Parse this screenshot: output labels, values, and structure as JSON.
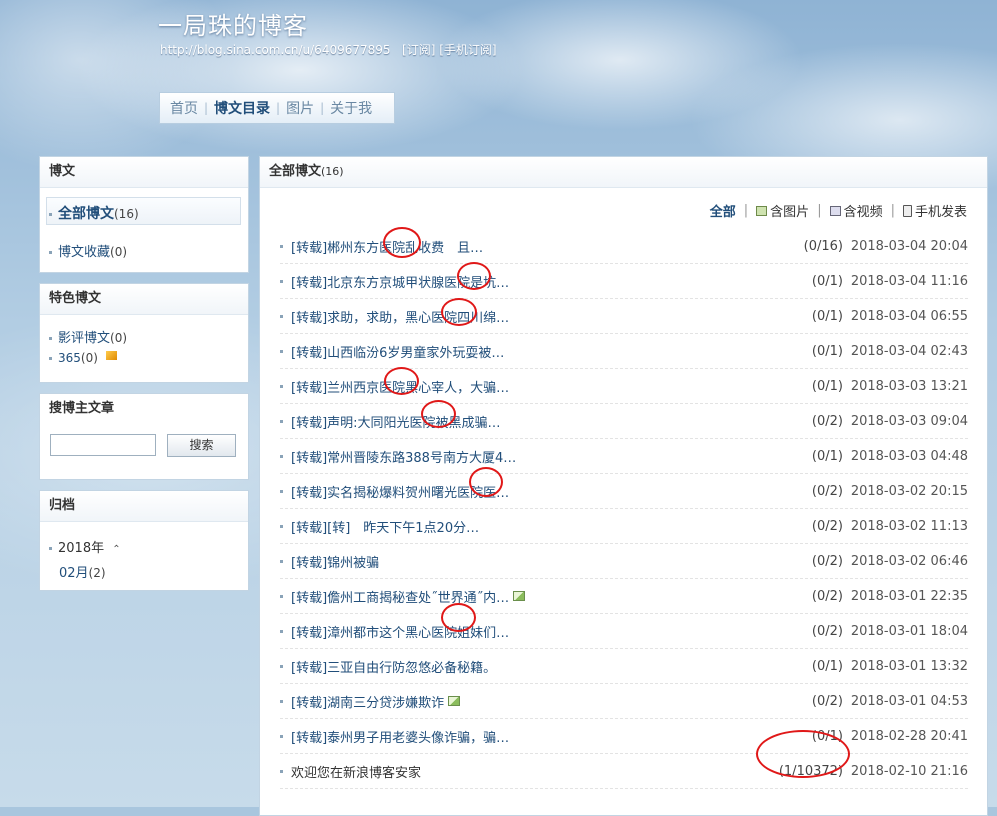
{
  "header": {
    "title": "一局珠的博客",
    "url": "http://blog.sina.com.cn/u/6409677895",
    "subscribe": "[订阅]",
    "mobile_subscribe": "[手机订阅]"
  },
  "nav": {
    "items": [
      {
        "label": "首页",
        "active": false
      },
      {
        "label": "博文目录",
        "active": true
      },
      {
        "label": "图片",
        "active": false
      },
      {
        "label": "关于我",
        "active": false
      }
    ]
  },
  "sidebar": {
    "articles": {
      "title": "博文",
      "all_label": "全部博文",
      "all_count": "(16)",
      "fav_label": "博文收藏",
      "fav_count": "(0)"
    },
    "featured": {
      "title": "特色博文",
      "film_label": "影评博文",
      "film_count": "(0)",
      "c365_label": "365",
      "c365_count": "(0)"
    },
    "search": {
      "title": "搜博主文章",
      "button": "搜索",
      "input_value": ""
    },
    "archive": {
      "title": "归档",
      "year": "2018年",
      "month": "02月",
      "month_count": "(2)"
    }
  },
  "main": {
    "title": "全部博文",
    "count": "(16)",
    "filters": {
      "all": "全部",
      "pictures": "含图片",
      "videos": "含视频",
      "mobile": "手机发表"
    },
    "posts": [
      {
        "title": "[转载]郴州东方医院乱收费　且…",
        "stat": "(0/16)",
        "date": "2018-03-04 20:04"
      },
      {
        "title": "[转载]北京东方京城甲状腺医院是坑…",
        "stat": "(0/1)",
        "date": "2018-03-04 11:16"
      },
      {
        "title": "[转载]求助，求助，黑心医院四川绵…",
        "stat": "(0/1)",
        "date": "2018-03-04 06:55"
      },
      {
        "title": "[转载]山西临汾6岁男童家外玩耍被…",
        "stat": "(0/1)",
        "date": "2018-03-04 02:43"
      },
      {
        "title": "[转载]兰州西京医院黑心宰人，大骗…",
        "stat": "(0/1)",
        "date": "2018-03-03 13:21"
      },
      {
        "title": "[转载]声明:大同阳光医院被黑成骗…",
        "stat": "(0/2)",
        "date": "2018-03-03 09:04"
      },
      {
        "title": "[转载]常州晋陵东路388号南方大厦4…",
        "stat": "(0/1)",
        "date": "2018-03-03 04:48"
      },
      {
        "title": "[转载]实名揭秘爆料贺州曙光医院医…",
        "stat": "(0/2)",
        "date": "2018-03-02 20:15"
      },
      {
        "title": "[转载][转]　昨天下午1点20分…",
        "stat": "(0/2)",
        "date": "2018-03-02 11:13"
      },
      {
        "title": "[转载]锦州被骗",
        "stat": "(0/2)",
        "date": "2018-03-02 06:46"
      },
      {
        "title": "[转载]儋州工商揭秘查处˝世界通˝内…",
        "stat": "(0/2)",
        "date": "2018-03-01 22:35",
        "has_image": true
      },
      {
        "title": "[转载]漳州都市这个黑心医院姐妹们…",
        "stat": "(0/2)",
        "date": "2018-03-01 18:04"
      },
      {
        "title": "[转载]三亚自由行防忽悠必备秘籍。",
        "stat": "(0/1)",
        "date": "2018-03-01 13:32"
      },
      {
        "title": "[转载]湖南三分贷涉嫌欺诈",
        "stat": "(0/2)",
        "date": "2018-03-01 04:53",
        "has_image": true
      },
      {
        "title": "[转载]泰州男子用老婆头像诈骗，骗…",
        "stat": "(0/1)",
        "date": "2018-02-28 20:41"
      },
      {
        "title": "欢迎您在新浪博客安家",
        "stat": "(1/10372)",
        "date": "2018-02-10 21:16"
      }
    ]
  },
  "colors": {
    "link": "#214e7a",
    "annotation": "#e01818"
  }
}
